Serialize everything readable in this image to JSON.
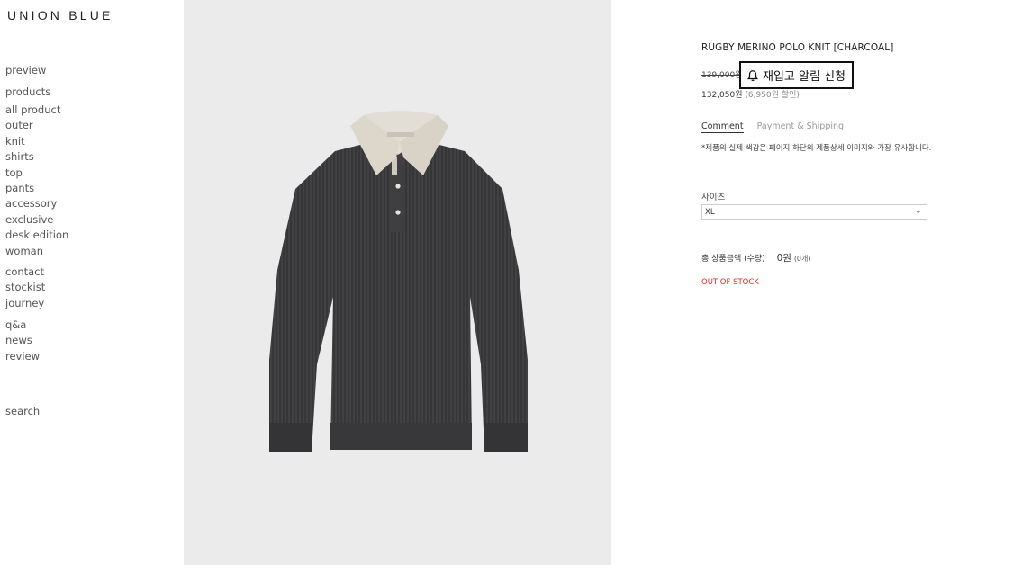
{
  "brand": {
    "logo": "UNION BLUE"
  },
  "nav": {
    "top": [
      {
        "label": "preview"
      },
      {
        "label": "products"
      }
    ],
    "products": [
      {
        "label": "all product"
      },
      {
        "label": "outer"
      },
      {
        "label": "knit"
      },
      {
        "label": "shirts"
      },
      {
        "label": "top"
      },
      {
        "label": "pants"
      },
      {
        "label": "accessory"
      },
      {
        "label": "exclusive"
      },
      {
        "label": "desk edition"
      },
      {
        "label": "woman"
      }
    ],
    "info": [
      {
        "label": "contact"
      },
      {
        "label": "stockist"
      },
      {
        "label": "journey"
      }
    ],
    "board": [
      {
        "label": "q&a"
      },
      {
        "label": "news"
      },
      {
        "label": "review"
      }
    ],
    "search": "search"
  },
  "product": {
    "title": "RUGBY MERINO POLO KNIT [CHARCOAL]",
    "original_price": "139,000원",
    "restock_button": "재입고 알림 신청",
    "restock_icon": "bell-icon",
    "sale_price": "132,050원",
    "discount": "(6,950원 할인)",
    "tabs": [
      {
        "label": "Comment",
        "active": true
      },
      {
        "label": "Payment & Shipping",
        "active": false
      }
    ],
    "note": "*제품의 실제 색감은 페이지 하단의 제품상세 이미지와 가장 유사합니다.",
    "size_label": "사이즈",
    "size_value": "XL",
    "total_label": "총 상품금액 (수량)",
    "total_amount": "0원",
    "total_count": "(0개)",
    "stock_status": "OUT OF STOCK"
  },
  "colors": {
    "accent_red": "#e0271b",
    "photo_bg": "#ebebeb",
    "knit": "#3a3a3c",
    "collar": "#ddd8ce"
  }
}
